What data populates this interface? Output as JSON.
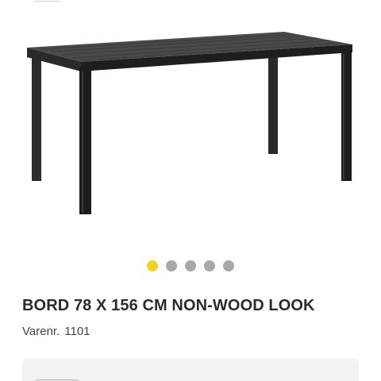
{
  "product": {
    "title": "BORD 78 X 156 CM NON-WOOD LOOK",
    "sku_label": "Varenr.",
    "sku_value": "1101"
  },
  "gallery": {
    "image_subject": "black rectangular outdoor table",
    "dot_count": 5,
    "active_index": 0
  },
  "colors": {
    "accent_yellow": "#f2d024",
    "dot_inactive": "#a8a8a8",
    "title_text": "#2b2b2b",
    "panel_bg": "#f2f2f2"
  }
}
